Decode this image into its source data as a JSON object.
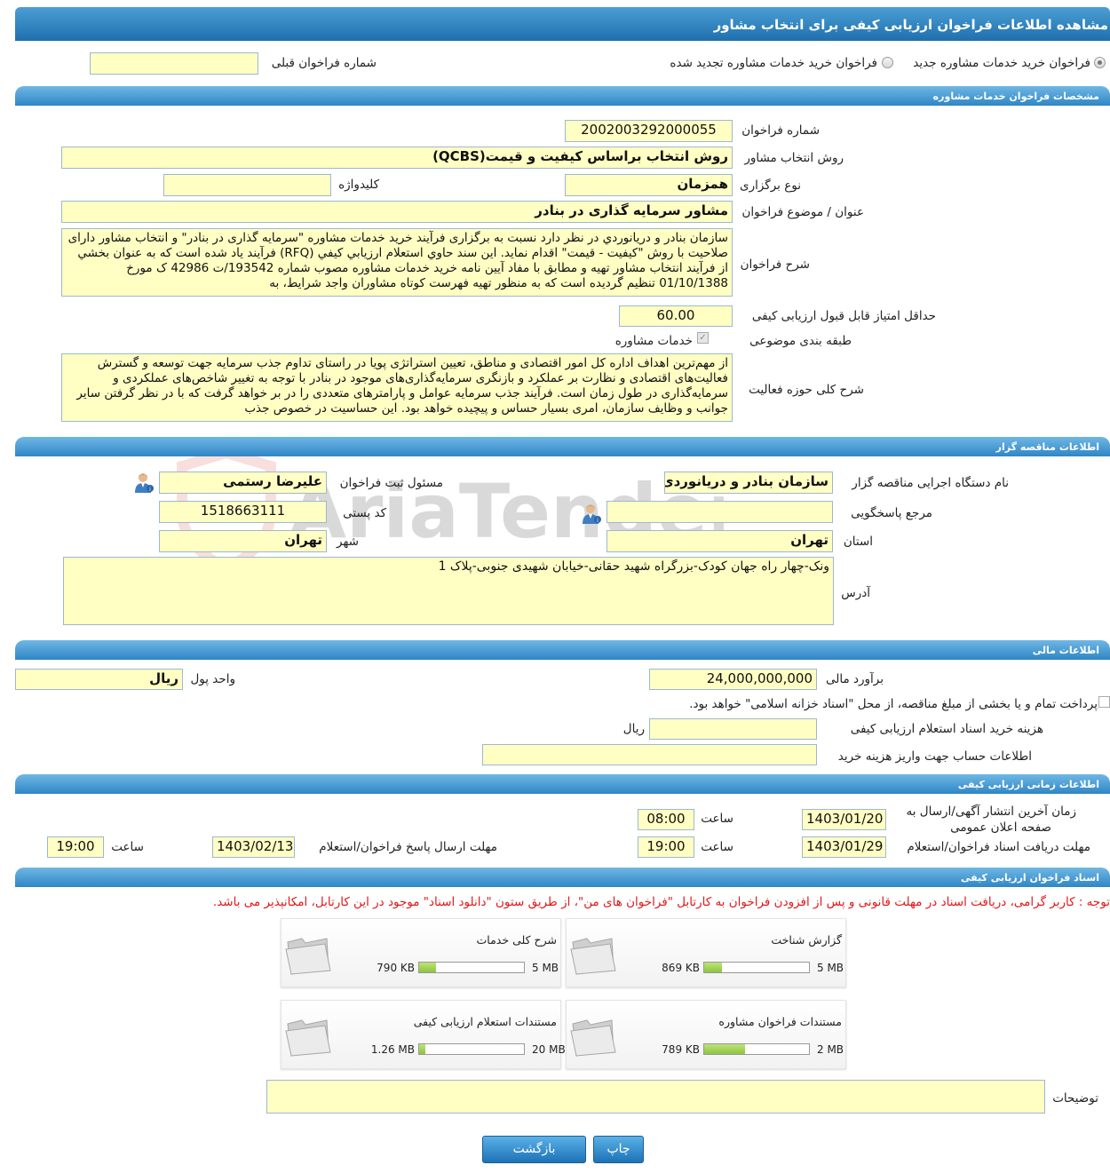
{
  "page_title": "مشاهده اطلاعات فراخوان ارزیابی کیفی برای انتخاب مشاور",
  "top": {
    "radio_new": "فراخوان خرید خدمات مشاوره جدید",
    "radio_renewed": "فراخوان خرید خدمات مشاوره تجدید شده",
    "prev_number_label": "شماره فراخوان قبلی",
    "prev_number_value": ""
  },
  "sections": {
    "specs": "مشخصات فراخوان خدمات مشاوره",
    "tenderer": "اطلاعات مناقصه گزار",
    "financial": "اطلاعات مالی",
    "timing": "اطلاعات زمانی ارزیابی کیفی",
    "documents": "اسناد فراخوان ارزیابی کیفی"
  },
  "specs": {
    "number_label": "شماره فراخوان",
    "number_value": "2002003292000055",
    "method_label": "روش انتخاب مشاور",
    "method_value": "روش انتخاب براساس کیفیت و قیمت(QCBS)",
    "type_label": "نوع برگزاری",
    "type_value": "همزمان",
    "keyword_label": "کلیدواژه",
    "keyword_value": "",
    "subject_label": "عنوان / موضوع فراخوان",
    "subject_value": "مشاور سرمایه گذاری در بنادر",
    "desc_label": "شرح فراخوان",
    "desc_value": "سازمان بنادر و دريانوردي در نظر دارد نسبت به برگزاری فرآیند خرید خدمات مشاوره \"سرمایه گذاری در بنادر\" و انتخاب مشاور دارای صلاحیت با روش \"کیفیت - قیمت\" اقدام نماید. این سند حاوي استعلام ارزیابي کیفي (RFQ) فرآيند ياد شده است که به عنوان بخشي از فرآیند انتخاب مشاور تهيه و مطابق با مفاد آیین نامه خرید خدمات مشاوره مصوب شماره 193542/ت 42986 ک مورخ 01/10/1388 تنظیم گرديده است که به منظور تهيه فهرست کوتاه مشاوران واجد شرایط، به",
    "min_score_label": "حداقل امتیاز قابل قبول ارزیابی کیفی",
    "min_score_value": "60.00",
    "category_label": "طبقه بندی موضوعی",
    "category_value": "خدمات مشاوره",
    "activity_label": "شرح کلی حوزه فعالیت",
    "activity_value": "از مهم‌ترین اهداف اداره کل امور اقتصادی و مناطق، تعیین استراتژی پویا در راستای تداوم جذب سرمایه جهت توسعه و گسترش فعالیت‌های اقتصادی و نظارت بر عملکرد و  بازنگری سرمایه‌گذاری‌های موجود در بنادر با توجه به تغییر شاخص‌های عملکردی و سرمایه‌گذاری در طول زمان است. فرآیند جذب سرمایه عوامل و پارامترهای متعددی را در بر خواهد گرفت که با در نظر گرفتن سایر جوانب و وظایف سازمان، امری بسیار حساس و پیچیده خواهد بود. این حساسیت در خصوص جذب"
  },
  "tenderer": {
    "org_label": "نام دستگاه اجرایی مناقصه گزار",
    "org_value": "سازمان بنادر و دریانوردی",
    "registrar_label": "مسئول ثبت فراخوان",
    "registrar_value": "علیرضا رستمی",
    "ref_label": "مرجع پاسخگویی",
    "ref_value": "",
    "postal_label": "کد پستی",
    "postal_value": "1518663111",
    "province_label": "استان",
    "province_value": "تهران",
    "city_label": "شهر",
    "city_value": "تهران",
    "address_label": "آدرس",
    "address_value": "ونک-چهار راه جهان کودک-بزرگراه شهید حقانی-خیابان شهیدی جنوبی-پلاک 1"
  },
  "financial": {
    "estimate_label": "برآورد مالی",
    "estimate_value": "24,000,000,000",
    "currency_label": "واحد پول",
    "currency_value": "ریال",
    "treasury_text": "پرداخت تمام و یا بخشی از مبلغ مناقصه، از محل \"اسناد خزانه اسلامی\" خواهد بود.",
    "doc_fee_label": "هزینه خرید اسناد استعلام ارزیابی کیفی",
    "doc_fee_value": "",
    "doc_fee_unit": "ریال",
    "account_label": "اطلاعات حساب جهت واریز هزینه خرید",
    "account_value": ""
  },
  "timing": {
    "publish_label_1": "زمان آخرین انتشار آگهی/ارسال به",
    "publish_label_2": "صفحه اعلان عمومی",
    "publish_date": "1403/01/20",
    "publish_time_label": "ساعت",
    "publish_time": "08:00",
    "receive_label": "مهلت دریافت اسناد فراخوان/استعلام",
    "receive_date": "1403/01/29",
    "receive_time_label": "ساعت",
    "receive_time": "19:00",
    "reply_label": "مهلت ارسال پاسخ فراخوان/استعلام",
    "reply_date": "1403/02/13",
    "reply_time_label": "ساعت",
    "reply_time": "19:00"
  },
  "documents": {
    "notice": "توجه : کاربر گرامی، دریافت اسناد در مهلت قانونی و پس از افزودن فراخوان به کارتابل \"فراخوان های من\"، از طریق ستون \"دانلود اسناد\" موجود در این کارتابل، امکانپذیر می باشد.",
    "items": [
      {
        "title": "گزارش شناخت",
        "size": "869 KB",
        "max": "5 MB",
        "fill": 0.17
      },
      {
        "title": "شرح کلی خدمات",
        "size": "790 KB",
        "max": "5 MB",
        "fill": 0.16
      },
      {
        "title": "مستندات فراخوان مشاوره",
        "size": "789 KB",
        "max": "2 MB",
        "fill": 0.39
      },
      {
        "title": "مستندات استعلام ارزیابی کیفی",
        "size": "1.26 MB",
        "max": "20 MB",
        "fill": 0.06
      }
    ],
    "notes_label": "توضیحات",
    "notes_value": ""
  },
  "buttons": {
    "print": "چاپ",
    "back": "بازگشت"
  },
  "watermark": "AriaTender.neT"
}
